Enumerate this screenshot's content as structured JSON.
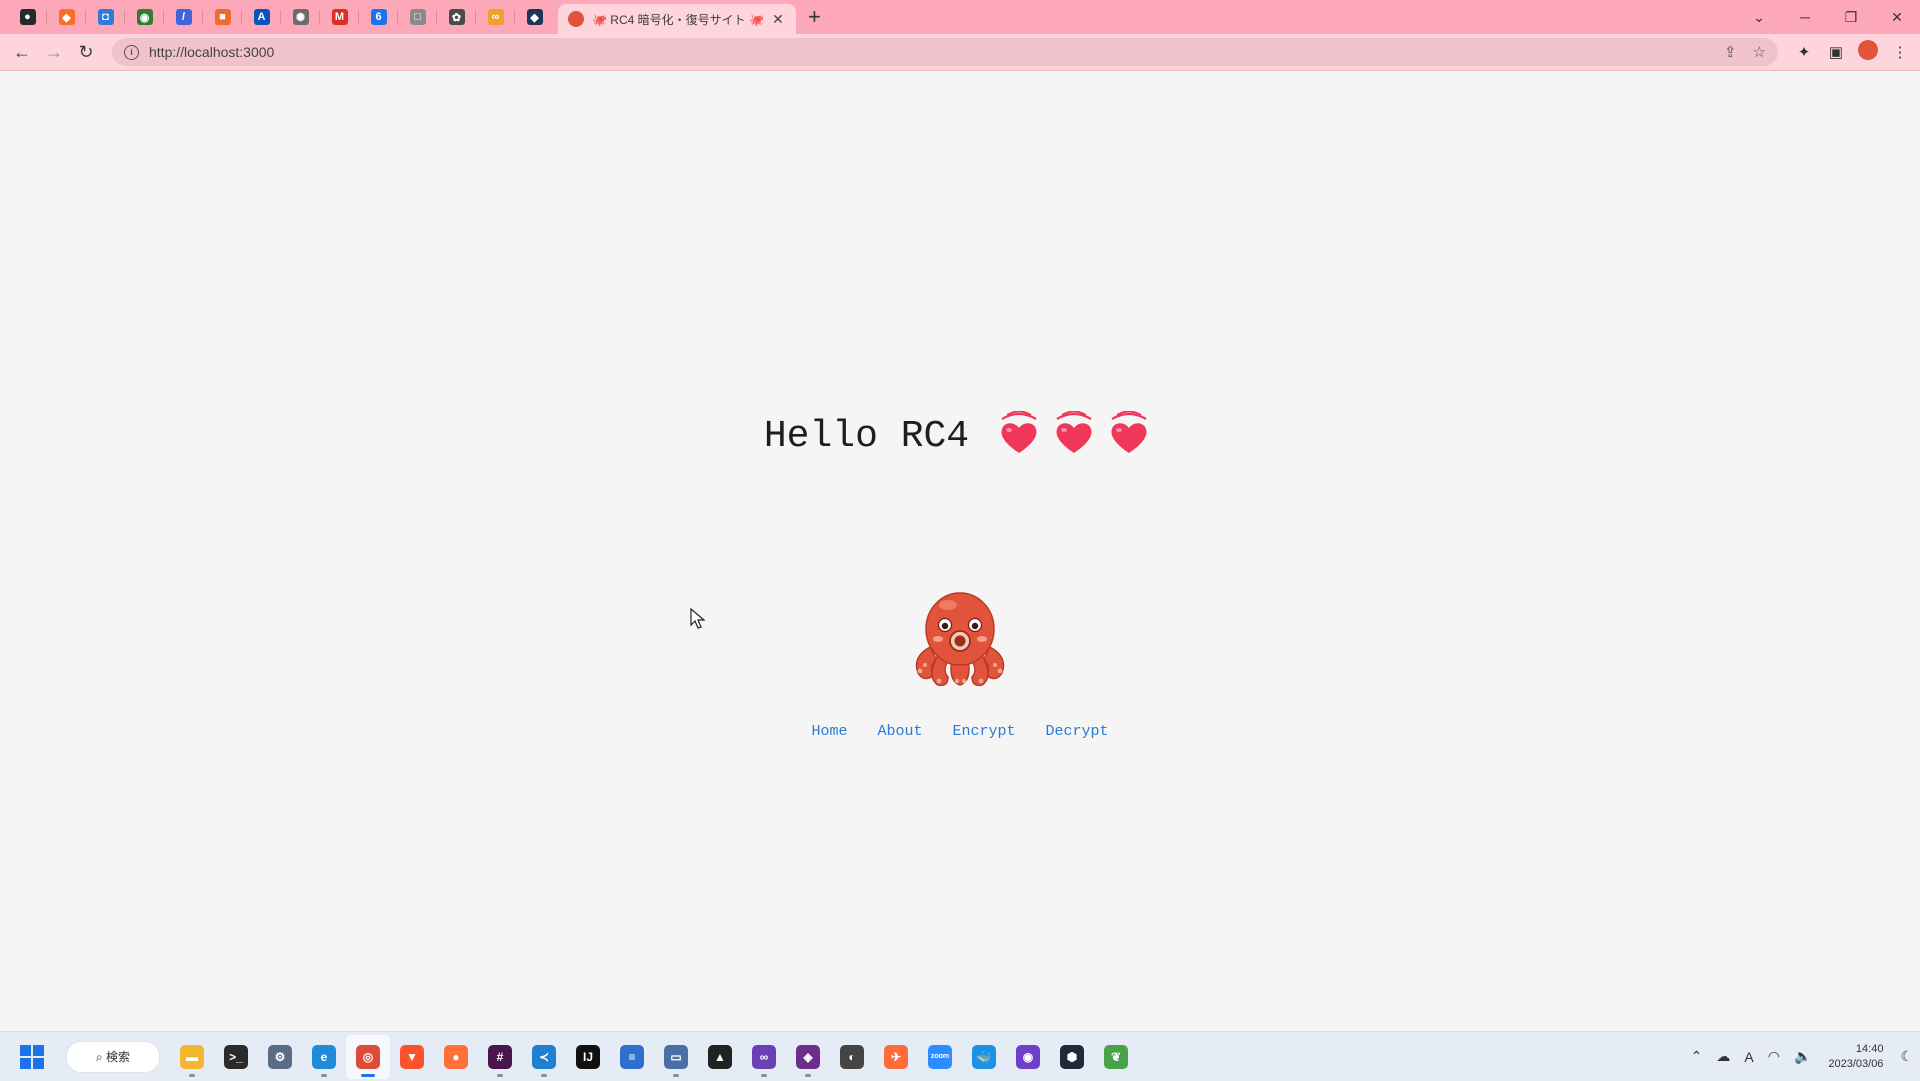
{
  "browser": {
    "pinned_tabs": [
      {
        "icon": "github-icon",
        "color": "#24292f",
        "glyph": "●"
      },
      {
        "icon": "gitlab-icon",
        "color": "#fc6d26",
        "glyph": "◆"
      },
      {
        "icon": "azure-devops-icon",
        "color": "#2f7bd6",
        "glyph": "◘"
      },
      {
        "icon": "circle-logo-icon",
        "color": "#2e7d32",
        "glyph": "◉"
      },
      {
        "icon": "stripe-icon",
        "color": "#3f63d8",
        "glyph": "/"
      },
      {
        "icon": "box-icon",
        "color": "#f06a2b",
        "glyph": "■"
      },
      {
        "icon": "atlassian-icon",
        "color": "#0a53be",
        "glyph": "A"
      },
      {
        "icon": "chatgpt-icon",
        "color": "#6b6b6b",
        "glyph": "✺"
      },
      {
        "icon": "gmail-icon",
        "color": "#d93025",
        "glyph": "M"
      },
      {
        "icon": "calendar-icon",
        "color": "#1a73e8",
        "glyph": "6"
      },
      {
        "icon": "notion-icon",
        "color": "#8a8a8a",
        "glyph": "□"
      },
      {
        "icon": "openai-icon",
        "color": "#4a4a4a",
        "glyph": "✿"
      },
      {
        "icon": "link-icon",
        "color": "#f0a030",
        "glyph": "∞"
      },
      {
        "icon": "diamond-icon",
        "color": "#1d3557",
        "glyph": "◆"
      }
    ],
    "active_tab": {
      "title": "🐙 RC4 暗号化・復号サイト 🐙",
      "close": "✕"
    },
    "new_tab": "+",
    "window_controls": {
      "list": "⌄",
      "minimize": "─",
      "restore": "❐",
      "close": "✕"
    },
    "nav": {
      "back": "←",
      "forward": "→",
      "reload": "↻"
    },
    "url": "http://localhost:3000",
    "omnibox_icons": {
      "share": "⇪",
      "bookmark": "☆"
    },
    "toolbar_icons": {
      "extensions": "✦",
      "sidebar": "▣",
      "menu": "⋮"
    }
  },
  "page": {
    "heading": "Hello RC4",
    "heart_count": 3,
    "heart_color": "#f0375a",
    "nav_links": [
      "Home",
      "About",
      "Encrypt",
      "Decrypt"
    ],
    "accent_color": "#2b7bd2"
  },
  "taskbar": {
    "search_label": "⌕ 検索",
    "apps": [
      {
        "name": "file-explorer-icon",
        "color": "#f2b630",
        "glyph": "▬",
        "running": true
      },
      {
        "name": "terminal-icon",
        "color": "#2b2b2b",
        "glyph": ">_",
        "running": false
      },
      {
        "name": "settings-icon",
        "color": "#5a6b85",
        "glyph": "⚙",
        "running": false
      },
      {
        "name": "edge-icon",
        "color": "#1f8ad8",
        "glyph": "e",
        "running": true
      },
      {
        "name": "chrome-icon",
        "color": "#dd4b39",
        "glyph": "◎",
        "running": true,
        "current": true
      },
      {
        "name": "brave-icon",
        "color": "#fb542b",
        "glyph": "▼",
        "running": false
      },
      {
        "name": "firefox-icon",
        "color": "#ff7139",
        "glyph": "●",
        "running": false
      },
      {
        "name": "slack-icon",
        "color": "#4a154b",
        "glyph": "#",
        "running": true
      },
      {
        "name": "vscode-icon",
        "color": "#1f7fd0",
        "glyph": "≺",
        "running": true
      },
      {
        "name": "intellij-icon",
        "color": "#111",
        "glyph": "IJ",
        "running": false
      },
      {
        "name": "notepad-icon",
        "color": "#2f6fd0",
        "glyph": "≡",
        "running": false
      },
      {
        "name": "remote-desktop-icon",
        "color": "#4a6fa5",
        "glyph": "▭",
        "running": true
      },
      {
        "name": "inkscape-icon",
        "color": "#222",
        "glyph": "▲",
        "running": false
      },
      {
        "name": "visual-studio-icon",
        "color": "#6c3fb5",
        "glyph": "∞",
        "running": true
      },
      {
        "name": "git-tool-icon",
        "color": "#6d2d8c",
        "glyph": "◈",
        "running": true
      },
      {
        "name": "postman-like-icon",
        "color": "#444",
        "glyph": "◐",
        "running": false
      },
      {
        "name": "postman-icon",
        "color": "#ff6c37",
        "glyph": "✈",
        "running": false
      },
      {
        "name": "zoom-icon",
        "color": "#2d8cff",
        "glyph": "zoom",
        "running": false
      },
      {
        "name": "docker-icon",
        "color": "#1d91e6",
        "glyph": "🐳",
        "running": false
      },
      {
        "name": "github-desktop-icon",
        "color": "#6e40c9",
        "glyph": "◉",
        "running": false
      },
      {
        "name": "cube-app-icon",
        "color": "#1c2a3a",
        "glyph": "⬢",
        "running": false
      },
      {
        "name": "mongodb-icon",
        "color": "#47a248",
        "glyph": "❦",
        "running": false
      }
    ],
    "tray": {
      "chevron": "⌃",
      "cloud": "☁",
      "ime": "A",
      "wifi": "◠",
      "volume": "🔈",
      "moon": "☾"
    },
    "time": "14:40",
    "date": "2023/03/06"
  }
}
